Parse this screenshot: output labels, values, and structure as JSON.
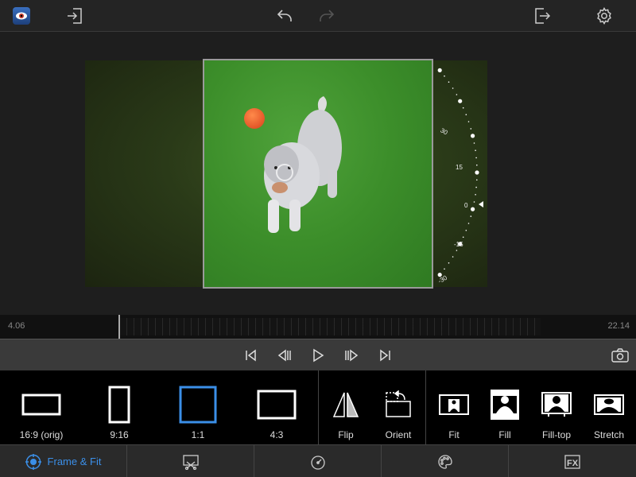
{
  "colors": {
    "accent": "#3b8fe8",
    "panel": "#000000",
    "topbar": "#242424"
  },
  "topbar": {
    "icons": [
      "app-eye-icon",
      "import-icon",
      "undo-icon",
      "redo-icon",
      "export-icon",
      "gear-icon"
    ]
  },
  "preview": {
    "dial_labels": [
      "30",
      "15",
      "0",
      "-15",
      "-30"
    ]
  },
  "timeline": {
    "start_time": "4.06",
    "end_time": "22.14"
  },
  "transport": {
    "icons": [
      "skip-start-icon",
      "step-back-icon",
      "play-icon",
      "step-forward-icon",
      "skip-end-icon",
      "camera-icon"
    ]
  },
  "tools": {
    "aspect": [
      {
        "label": "16:9 (orig)",
        "selected": false
      },
      {
        "label": "9:16",
        "selected": false
      },
      {
        "label": "1:1",
        "selected": true
      },
      {
        "label": "4:3",
        "selected": false
      }
    ],
    "transform": [
      {
        "label": "Flip"
      },
      {
        "label": "Orient"
      }
    ],
    "fit": [
      {
        "label": "Fit"
      },
      {
        "label": "Fill"
      },
      {
        "label": "Fill-top"
      },
      {
        "label": "Stretch"
      }
    ]
  },
  "tabs": [
    {
      "label": "Frame & Fit",
      "active": true,
      "icon": "frame-fit-icon"
    },
    {
      "label": "",
      "icon": "trim-icon"
    },
    {
      "label": "",
      "icon": "speed-gauge-icon"
    },
    {
      "label": "",
      "icon": "palette-icon"
    },
    {
      "label": "",
      "icon": "fx-icon"
    }
  ]
}
